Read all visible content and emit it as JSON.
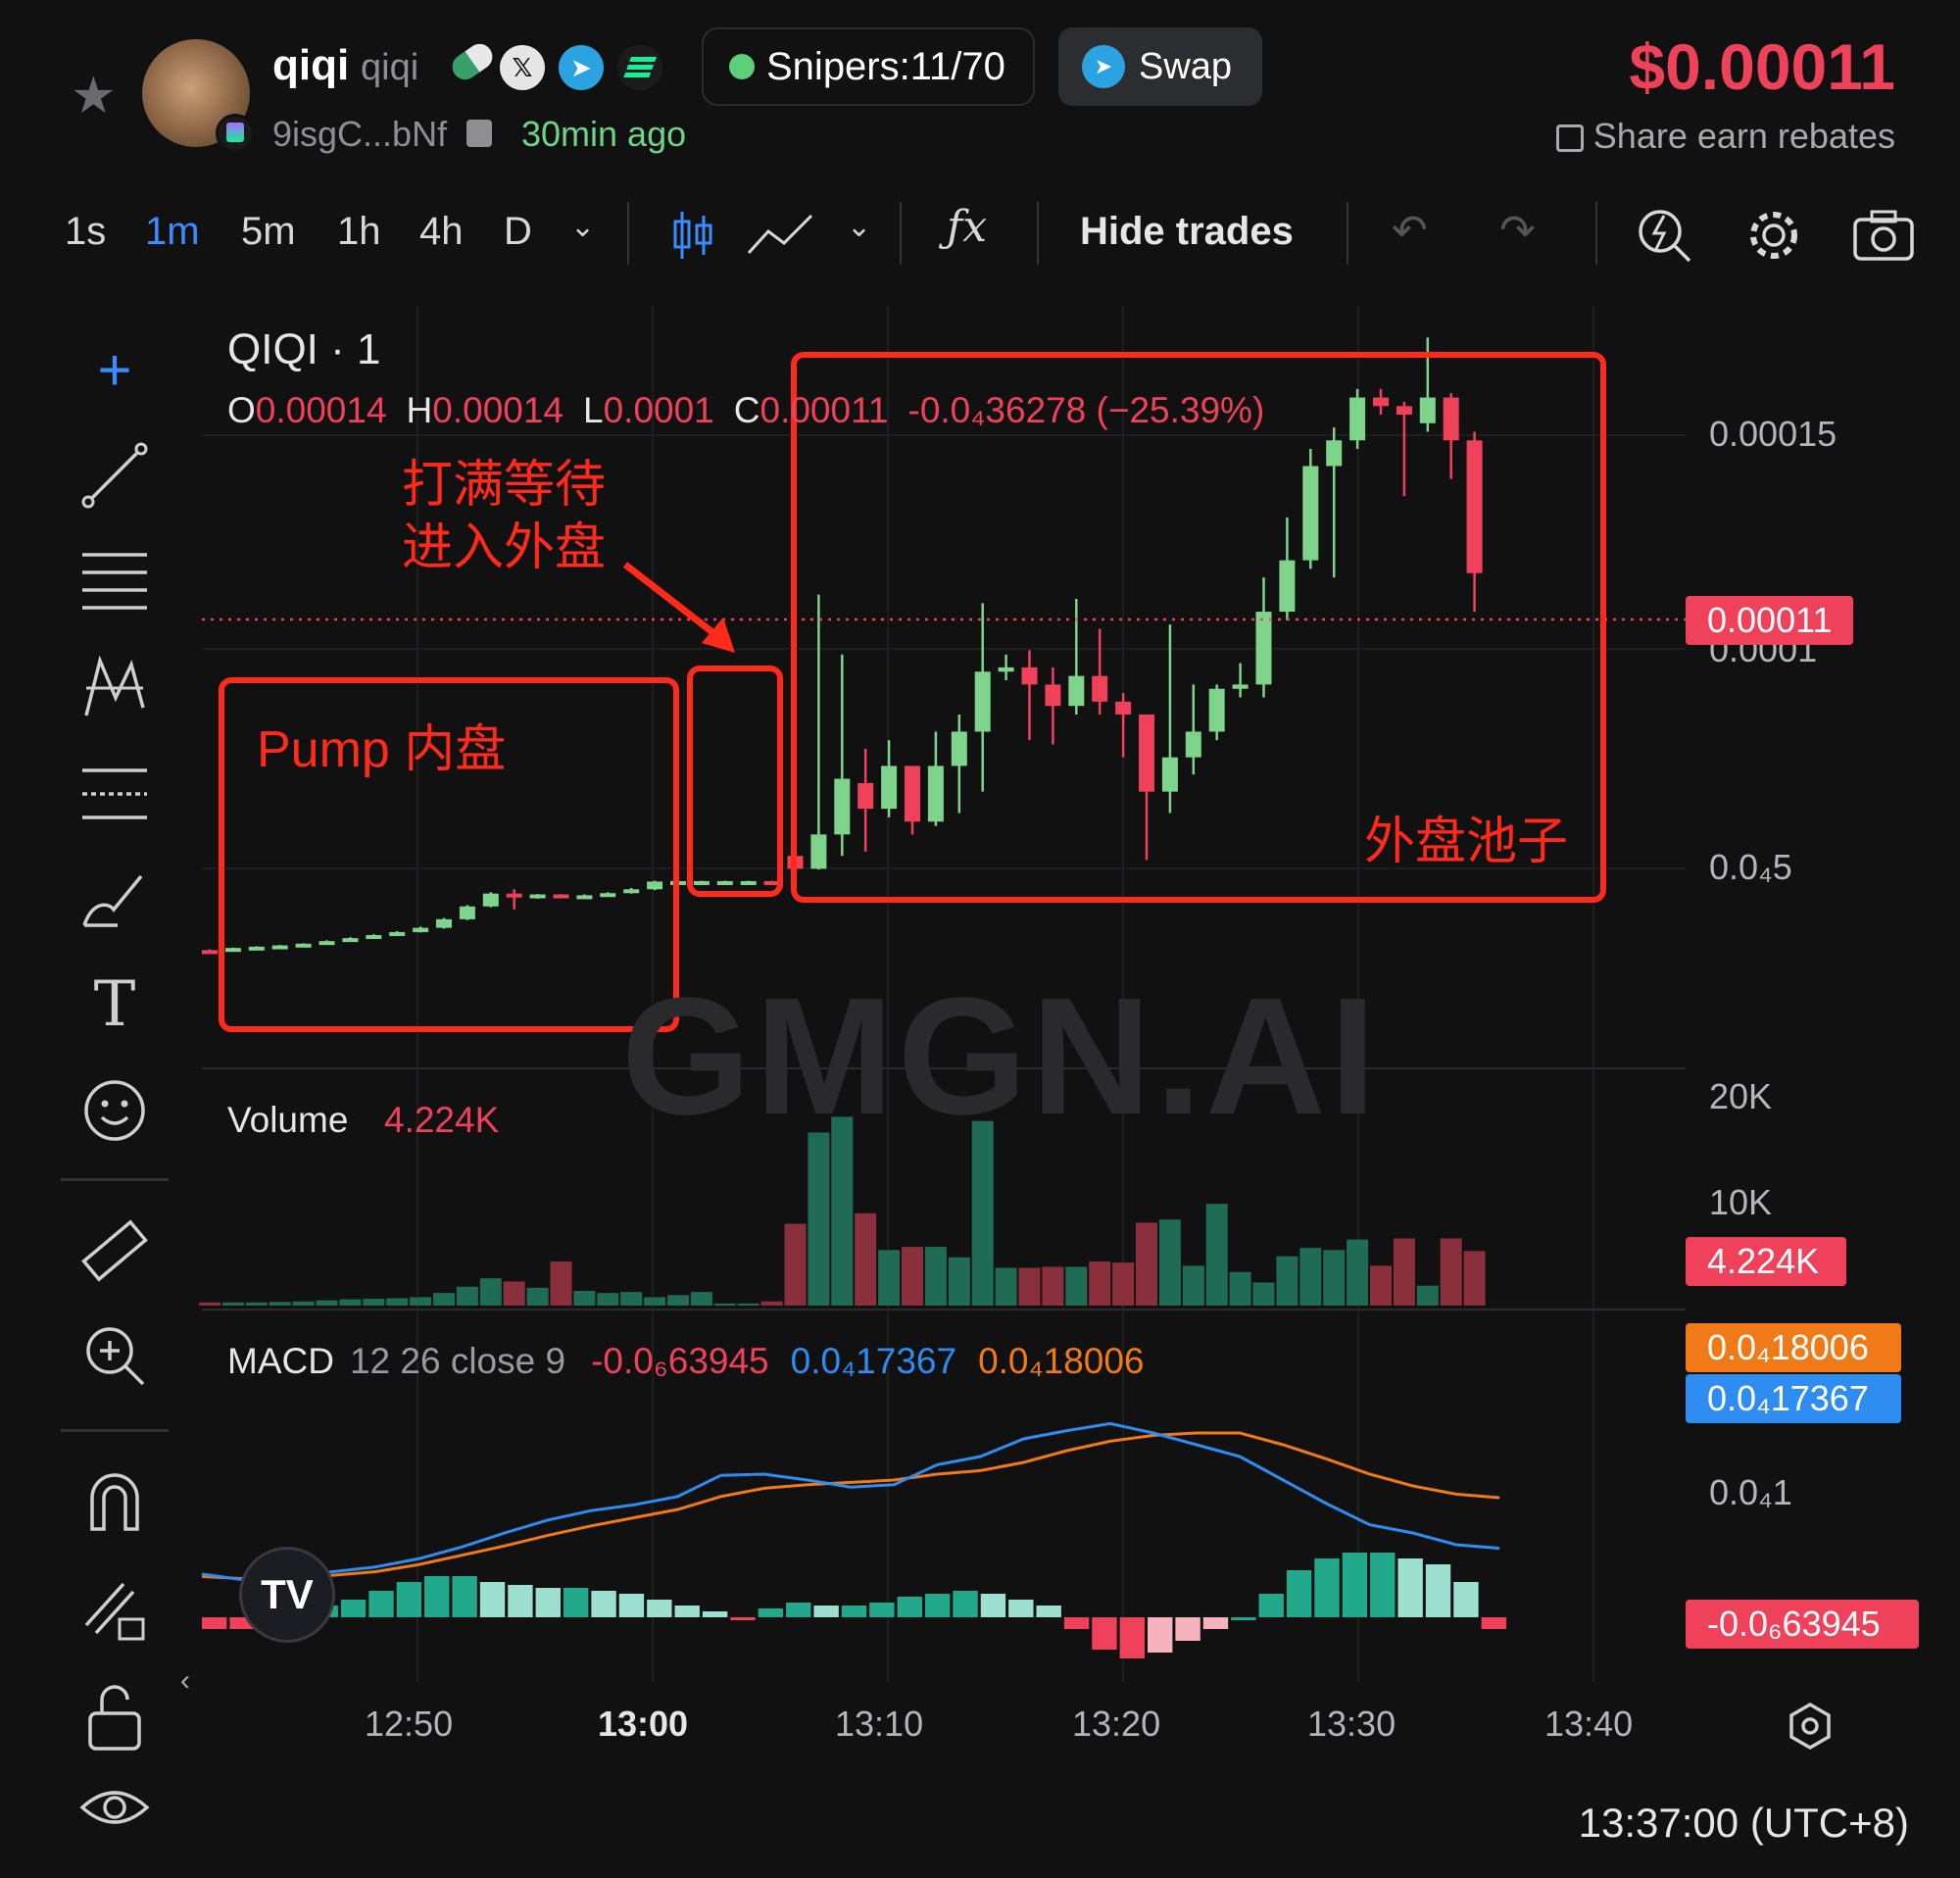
{
  "header": {
    "token_name": "qiqi",
    "token_symbol": "qiqi",
    "address": "9isgC...bNf",
    "age": "30min ago",
    "snipers": "Snipers:11/70",
    "swap_label": "Swap",
    "price": "$0.00011",
    "share_label": "Share earn rebates"
  },
  "toolbar": {
    "timeframes": [
      "1s",
      "1m",
      "5m",
      "1h",
      "4h",
      "D"
    ],
    "active_timeframe": "1m",
    "hide_trades_label": "Hide trades"
  },
  "chart": {
    "symbol_title": "QIQI · 1",
    "ohlc": {
      "o_label": "O",
      "o": "0.00014",
      "h_label": "H",
      "h": "0.00014",
      "l_label": "L",
      "l": "0.0001",
      "c_label": "C",
      "c": "0.00011",
      "change": "-0.0₄36278 (−25.39%)"
    },
    "price_axis": [
      "0.00015",
      "0.0001",
      "0.0₄5"
    ],
    "current_price_tag": "0.00011",
    "volume_label": "Volume",
    "volume_value": "4.224K",
    "volume_axis": [
      "20K",
      "10K"
    ],
    "volume_tag": "4.224K",
    "macd_label": "MACD",
    "macd_params": "12 26 close 9",
    "macd_hist": "-0.0₆63945",
    "macd_line": "0.0₄17367",
    "macd_signal": "0.0₄18006",
    "macd_axis": [
      "0.0₄1"
    ],
    "macd_tags": [
      "0.0₄18006",
      "0.0₄17367",
      "-0.0₆63945"
    ],
    "time_axis": [
      "12:50",
      "13:00",
      "13:10",
      "13:20",
      "13:30",
      "13:40"
    ],
    "clock": "13:37:00 (UTC+8)",
    "watermark": "GMGN.AI",
    "annotations": {
      "inner": "Pump 内盘",
      "waiting_line1": "打满等待",
      "waiting_line2": "进入外盘",
      "outer": "外盘池子"
    },
    "colors": {
      "up": "#7fd48c",
      "down": "#f0415a",
      "accent": "#3b8cff",
      "annotation": "#ff2a1a",
      "macd_line": "#2f8cf0",
      "macd_signal": "#f07a18"
    }
  },
  "chart_data": {
    "type": "candlestick",
    "title": "QIQI · 1",
    "ylim": [
      3e-05,
      0.000165
    ],
    "x_ticks": [
      "12:50",
      "13:00",
      "13:10",
      "13:20",
      "13:30",
      "13:40"
    ],
    "candles_ohlc": [
      [
        2.1e-05,
        2.12e-05,
        2.08e-05,
        2.09e-05
      ],
      [
        2.12e-05,
        2.16e-05,
        2.11e-05,
        2.15e-05
      ],
      [
        2.15e-05,
        2.19e-05,
        2.14e-05,
        2.18e-05
      ],
      [
        2.18e-05,
        2.22e-05,
        2.17e-05,
        2.21e-05
      ],
      [
        2.21e-05,
        2.26e-05,
        2.2e-05,
        2.25e-05
      ],
      [
        2.25e-05,
        2.33e-05,
        2.24e-05,
        2.31e-05
      ],
      [
        2.31e-05,
        2.4e-05,
        2.3e-05,
        2.38e-05
      ],
      [
        2.38e-05,
        2.47e-05,
        2.37e-05,
        2.45e-05
      ],
      [
        2.45e-05,
        2.54e-05,
        2.44e-05,
        2.52e-05
      ],
      [
        2.52e-05,
        2.65e-05,
        2.51e-05,
        2.62e-05
      ],
      [
        2.62e-05,
        2.85e-05,
        2.6e-05,
        2.82e-05
      ],
      [
        2.82e-05,
        3.15e-05,
        2.8e-05,
        3.12e-05
      ],
      [
        3.12e-05,
        3.45e-05,
        3.1e-05,
        3.42e-05
      ],
      [
        3.42e-05,
        3.52e-05,
        3.05e-05,
        3.37e-05
      ],
      [
        3.37e-05,
        3.41e-05,
        3.3e-05,
        3.4e-05
      ],
      [
        3.4e-05,
        3.41e-05,
        3.33e-05,
        3.35e-05
      ],
      [
        3.35e-05,
        3.4e-05,
        3.33e-05,
        3.38e-05
      ],
      [
        3.38e-05,
        3.45e-05,
        3.37e-05,
        3.43e-05
      ],
      [
        3.43e-05,
        3.55e-05,
        3.42e-05,
        3.52e-05
      ],
      [
        3.52e-05,
        3.72e-05,
        3.5e-05,
        3.7e-05
      ],
      [
        3.7e-05,
        3.72e-05,
        3.69e-05,
        3.71e-05
      ],
      [
        3.71e-05,
        3.72e-05,
        3.7e-05,
        3.71e-05
      ],
      [
        3.71e-05,
        3.72e-05,
        3.7e-05,
        3.71e-05
      ],
      [
        3.71e-05,
        3.72e-05,
        3.7e-05,
        3.71e-05
      ],
      [
        3.71e-05,
        3.72e-05,
        3.66e-05,
        3.68e-05
      ],
      [
        4.3e-05,
        4.4e-05,
        3.8e-05,
        4e-05
      ],
      [
        4e-05,
        0.000104,
        3.98e-05,
        4.8e-05
      ],
      [
        4.8e-05,
        9e-05,
        4.3e-05,
        6.1e-05
      ],
      [
        6e-05,
        6.8e-05,
        4.4e-05,
        5.4e-05
      ],
      [
        5.4e-05,
        7e-05,
        5.2e-05,
        6.4e-05
      ],
      [
        6.4e-05,
        6.4e-05,
        4.8e-05,
        5.1e-05
      ],
      [
        5.1e-05,
        7.2e-05,
        5e-05,
        6.4e-05
      ],
      [
        6.4e-05,
        7.6e-05,
        5.3e-05,
        7.2e-05
      ],
      [
        7.2e-05,
        0.000102,
        5.8e-05,
        8.6e-05
      ],
      [
        8.6e-05,
        9e-05,
        8.4e-05,
        8.7e-05
      ],
      [
        8.7e-05,
        9.1e-05,
        7e-05,
        8.3e-05
      ],
      [
        8.3e-05,
        8.7e-05,
        6.9e-05,
        7.8e-05
      ],
      [
        7.8e-05,
        0.000103,
        7.6e-05,
        8.5e-05
      ],
      [
        8.5e-05,
        9.6e-05,
        7.6e-05,
        7.9e-05
      ],
      [
        7.9e-05,
        8.1e-05,
        6.6e-05,
        7.6e-05
      ],
      [
        7.6e-05,
        7.6e-05,
        4.2e-05,
        5.8e-05
      ],
      [
        5.8e-05,
        9.7e-05,
        5.3e-05,
        6.6e-05
      ],
      [
        6.6e-05,
        8.3e-05,
        6.2e-05,
        7.2e-05
      ],
      [
        7.2e-05,
        8.3e-05,
        7e-05,
        8.2e-05
      ],
      [
        8.2e-05,
        8.8e-05,
        8e-05,
        8.3e-05
      ],
      [
        8.3e-05,
        0.000108,
        8e-05,
        0.0001
      ],
      [
        0.0001,
        0.000122,
        9.8e-05,
        0.000112
      ],
      [
        0.000112,
        0.000138,
        0.00011,
        0.000134
      ],
      [
        0.000134,
        0.000143,
        0.000108,
        0.00014
      ],
      [
        0.00014,
        0.000152,
        0.000138,
        0.00015
      ],
      [
        0.00015,
        0.000152,
        0.000146,
        0.000148
      ],
      [
        0.000148,
        0.000149,
        0.000127,
        0.000146
      ],
      [
        0.000144,
        0.000164,
        0.000142,
        0.00015
      ],
      [
        0.00015,
        0.000151,
        0.000131,
        0.00014
      ],
      [
        0.00014,
        0.000142,
        0.0001,
        0.000109
      ]
    ],
    "volume_ylim": [
      0,
      20000
    ],
    "volume": [
      300,
      300,
      300,
      350,
      400,
      500,
      600,
      650,
      700,
      800,
      1200,
      1800,
      2600,
      2300,
      1700,
      4200,
      1400,
      1200,
      1300,
      800,
      1000,
      1300,
      200,
      200,
      400,
      7800,
      16500,
      18000,
      8800,
      5300,
      5600,
      5600,
      4600,
      17600,
      3600,
      3600,
      3700,
      3700,
      4200,
      4100,
      7900,
      8200,
      3800,
      9700,
      3200,
      2200,
      4700,
      5500,
      5300,
      6300,
      3800,
      6400,
      1900,
      6400,
      5200,
      2900,
      4224
    ],
    "macd_line": [
      0.2,
      0.15,
      0.18,
      0.22,
      0.26,
      0.33,
      0.43,
      0.55,
      0.66,
      0.74,
      0.79,
      0.86,
      1.04,
      1.05,
      1.0,
      0.94,
      0.96,
      1.13,
      1.2,
      1.35,
      1.42,
      1.48,
      1.4,
      1.3,
      1.2,
      1.0,
      0.8,
      0.62,
      0.55,
      0.45,
      0.42
    ],
    "macd_signal": [
      0.18,
      0.16,
      0.17,
      0.19,
      0.22,
      0.28,
      0.36,
      0.44,
      0.53,
      0.61,
      0.68,
      0.75,
      0.86,
      0.93,
      0.96,
      0.98,
      1.0,
      1.05,
      1.08,
      1.15,
      1.25,
      1.33,
      1.38,
      1.4,
      1.4,
      1.3,
      1.18,
      1.05,
      0.95,
      0.88,
      0.85
    ],
    "macd_hist": [
      -0.2,
      -0.2,
      0.1,
      0.15,
      0.2,
      0.3,
      0.45,
      0.6,
      0.7,
      0.7,
      0.6,
      0.55,
      0.5,
      0.5,
      0.45,
      0.4,
      0.3,
      0.2,
      0.1,
      -0.05,
      0.15,
      0.25,
      0.2,
      0.2,
      0.25,
      0.35,
      0.4,
      0.45,
      0.4,
      0.3,
      0.2,
      -0.2,
      -0.55,
      -0.7,
      -0.6,
      -0.4,
      -0.2,
      0.0,
      0.4,
      0.8,
      1.0,
      1.1,
      1.1,
      1.0,
      0.9,
      0.6,
      -0.2
    ]
  }
}
